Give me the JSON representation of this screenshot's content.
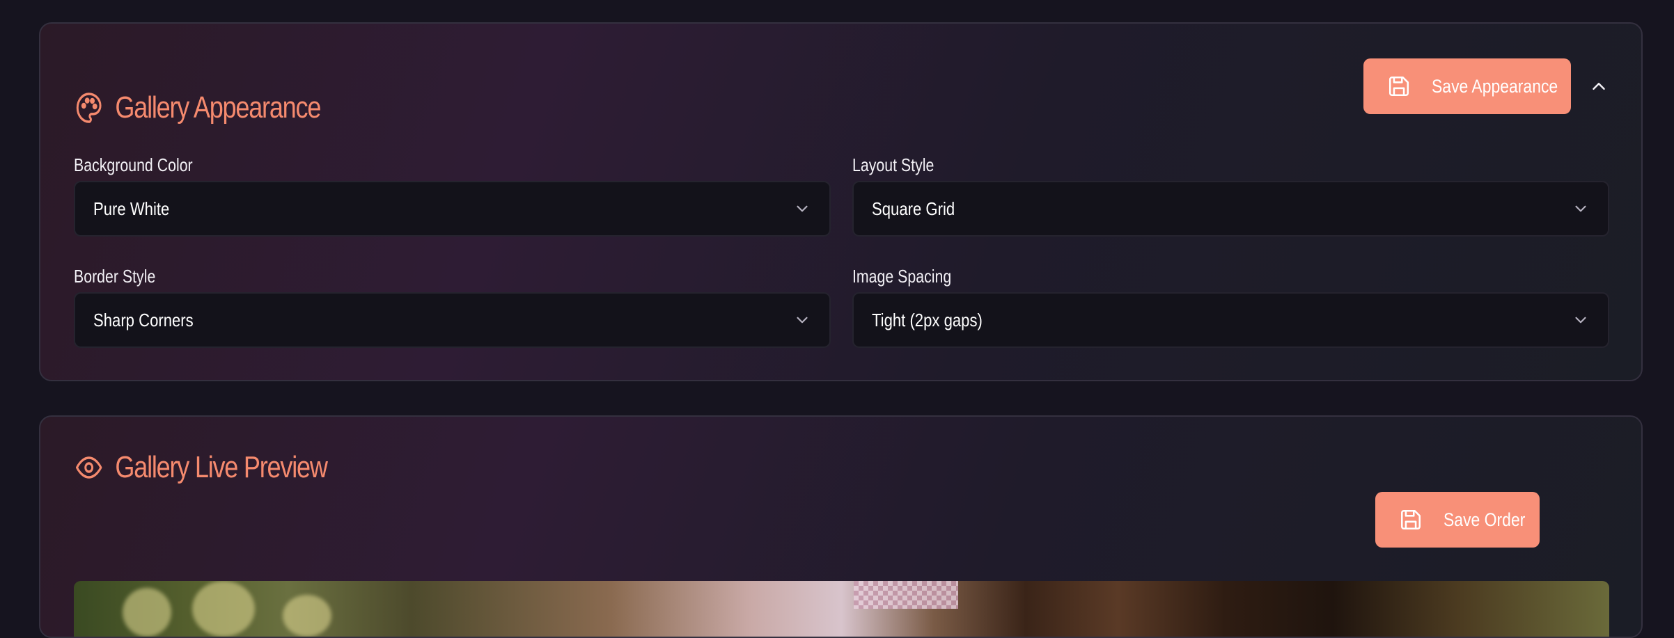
{
  "appearance": {
    "title": "Gallery Appearance",
    "save_label": "Save Appearance",
    "fields": {
      "background_color": {
        "label": "Background Color",
        "value": "Pure White"
      },
      "layout_style": {
        "label": "Layout Style",
        "value": "Square Grid"
      },
      "border_style": {
        "label": "Border Style",
        "value": "Sharp Corners"
      },
      "image_spacing": {
        "label": "Image Spacing",
        "value": "Tight (2px gaps)"
      }
    }
  },
  "preview": {
    "title": "Gallery Live Preview",
    "save_label": "Save Order"
  },
  "icons": {
    "appearance_title": "palette-icon",
    "preview_title": "eye-icon",
    "save": "floppy-disk-icon",
    "collapse": "chevron-up-icon",
    "select": "chevron-down-icon"
  },
  "colors": {
    "accent": "#f58a6e",
    "button_bg": "#f89078",
    "page_bg": "#16141f",
    "select_bg": "#13121a"
  }
}
